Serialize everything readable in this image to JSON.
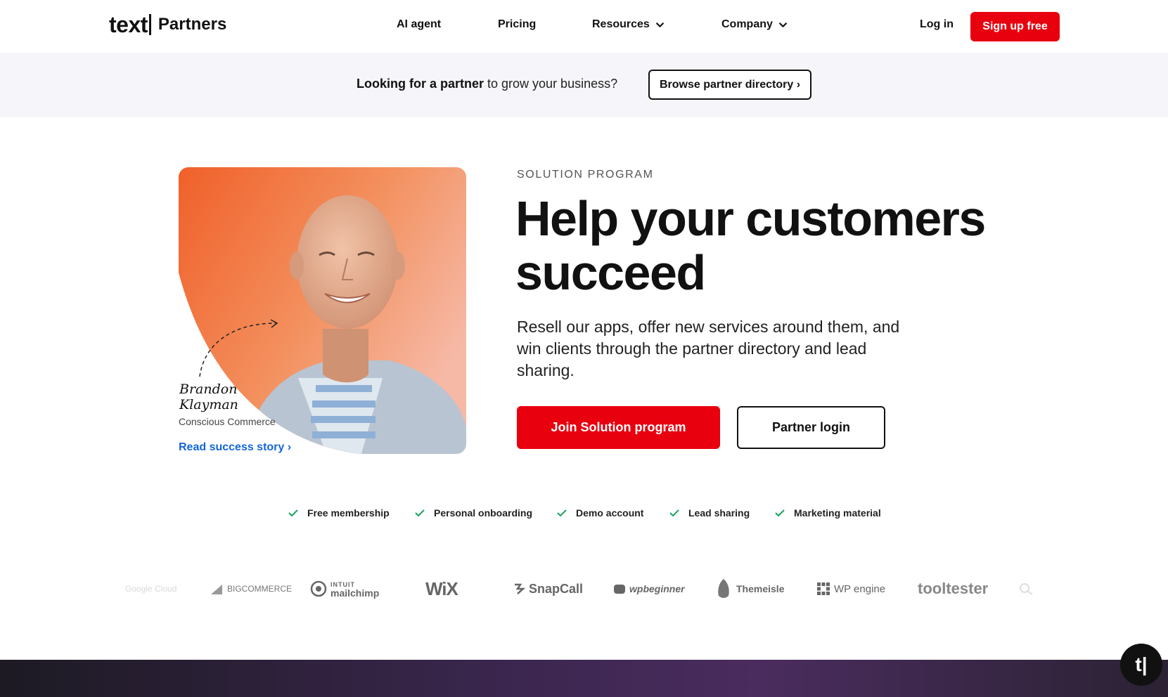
{
  "nav": {
    "logo_text": "text",
    "logo_sub": "Partners",
    "links": [
      {
        "label": "AI agent",
        "dropdown": false
      },
      {
        "label": "Pricing",
        "dropdown": false
      },
      {
        "label": "Resources",
        "dropdown": true
      },
      {
        "label": "Company",
        "dropdown": true
      }
    ],
    "login": "Log in",
    "signup": "Sign up free"
  },
  "banner": {
    "bold": "Looking for a partner",
    "rest": " to grow your business?",
    "button": "Browse partner directory ›"
  },
  "hero": {
    "signature_line1": "Brandon",
    "signature_line2": "Klayman",
    "company": "Conscious Commerce",
    "read_story": "Read success story ›",
    "eyebrow": "SOLUTION PROGRAM",
    "headline_line1": "Help your customers",
    "headline_line2": "succeed",
    "subtext": "Resell our apps, offer new services around them, and win clients through the partner directory and lead sharing.",
    "primary_button": "Join Solution program",
    "secondary_button": "Partner login"
  },
  "features": [
    "Free membership",
    "Personal onboarding",
    "Demo account",
    "Lead sharing",
    "Marketing material"
  ],
  "brands": [
    "Google Cloud",
    "BIGCOMMERCE",
    "mailchimp",
    "WiX",
    "SnapCall",
    "wpbeginner",
    "Themeisle",
    "WP engine",
    "tooltester"
  ],
  "brand_sub": {
    "mailchimp_top": "INTUIT"
  },
  "chat_widget": "t|",
  "colors": {
    "accent_red": "#e8000f",
    "link_blue": "#1466d8",
    "check_green": "#1aa260"
  }
}
